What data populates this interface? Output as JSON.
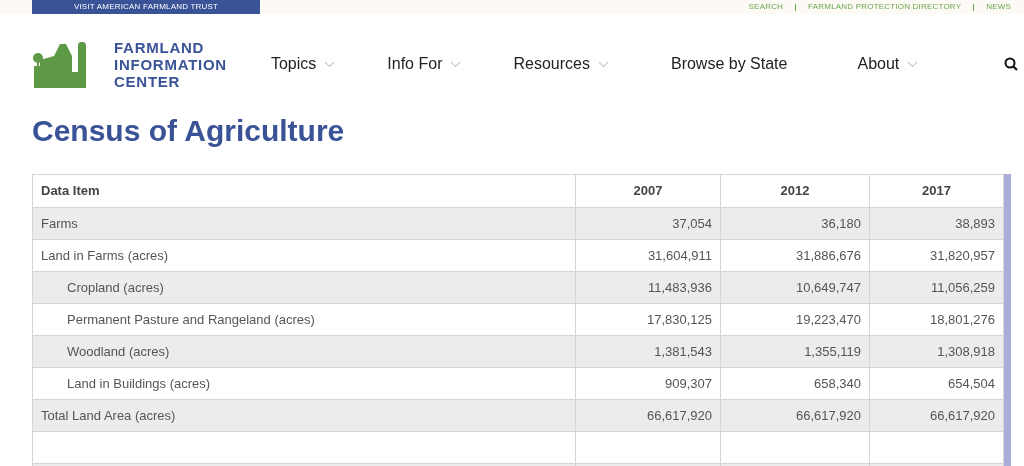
{
  "top_bar": {
    "button": "VISIT AMERICAN FARMLAND TRUST",
    "links": [
      "SEARCH",
      "FARMLAND PROTECTION DIRECTORY",
      "NEWS"
    ]
  },
  "logo": {
    "lines": [
      "FARMLAND",
      "INFORMATION",
      "CENTER"
    ]
  },
  "nav": [
    {
      "label": "Topics",
      "dropdown": true
    },
    {
      "label": "Info For",
      "dropdown": true
    },
    {
      "label": "Resources",
      "dropdown": true
    },
    {
      "label": "Browse by State",
      "dropdown": false
    },
    {
      "label": "About",
      "dropdown": true
    }
  ],
  "page_title": "Census of Agriculture",
  "table": {
    "columns": [
      "Data Item",
      "2007",
      "2012",
      "2017"
    ],
    "rows": [
      {
        "label": "Farms",
        "values": [
          "37,054",
          "36,180",
          "38,893"
        ]
      },
      {
        "label": "Land in Farms (acres)",
        "values": [
          "31,604,911",
          "31,886,676",
          "31,820,957"
        ],
        "children": [
          {
            "label": "Cropland (acres)",
            "values": [
              "11,483,936",
              "10,649,747",
              "11,056,259"
            ]
          },
          {
            "label": "Permanent Pasture and Rangeland (acres)",
            "values": [
              "17,830,125",
              "19,223,470",
              "18,801,276"
            ]
          },
          {
            "label": "Woodland (acres)",
            "values": [
              "1,381,543",
              "1,355,119",
              "1,308,918"
            ]
          },
          {
            "label": "Land in Buildings (acres)",
            "values": [
              "909,307",
              "658,340",
              "654,504"
            ]
          }
        ]
      },
      {
        "label": "Total Land Area (acres)",
        "values": [
          "66,617,920",
          "66,617,920",
          "66,617,920"
        ]
      }
    ]
  }
}
